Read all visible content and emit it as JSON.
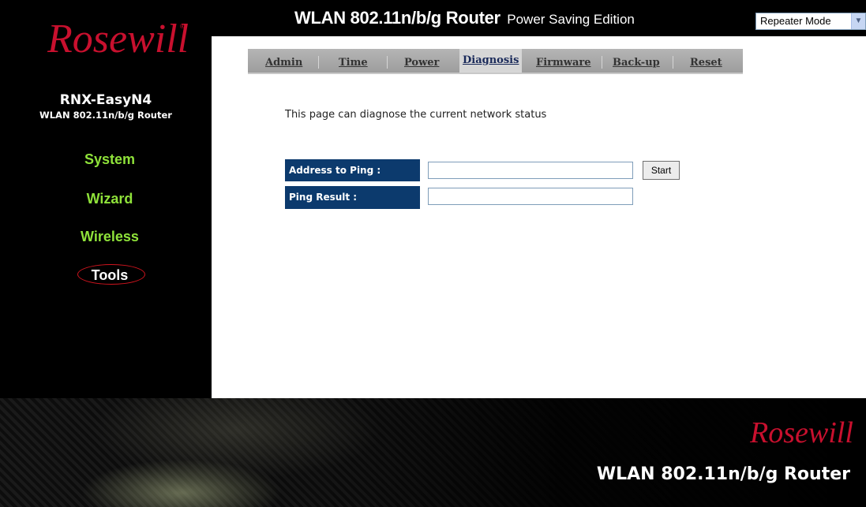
{
  "header": {
    "title_main": "WLAN 802.11n/b/g Router",
    "title_sub": "Power Saving Edition",
    "mode_select": {
      "selected": "Repeater Mode"
    }
  },
  "sidebar": {
    "logo_text": "Rosewill",
    "device_name": "RNX-EasyN4",
    "device_subtitle": "WLAN 802.11n/b/g Router",
    "items": [
      {
        "label": "System"
      },
      {
        "label": "Wizard"
      },
      {
        "label": "Wireless"
      },
      {
        "label": "Tools"
      }
    ]
  },
  "tabs": [
    {
      "label": "Admin"
    },
    {
      "label": "Time"
    },
    {
      "label": "Power"
    },
    {
      "label": "Diagnosis"
    },
    {
      "label": "Firmware"
    },
    {
      "label": "Back-up"
    },
    {
      "label": "Reset"
    }
  ],
  "active_tab": "Diagnosis",
  "content": {
    "description": "This page can diagnose the current network status",
    "ping_label": "Address to Ping :",
    "ping_value": "",
    "start_button": "Start",
    "result_label": "Ping Result :",
    "result_value": ""
  },
  "footer": {
    "logo_text": "Rosewill",
    "title": "WLAN 802.11n/b/g Router"
  },
  "colors": {
    "nav_green": "#8fe23a",
    "label_navy": "#0c3a6d",
    "logo_red": "#c8102e",
    "active_ring": "#d0141e"
  }
}
